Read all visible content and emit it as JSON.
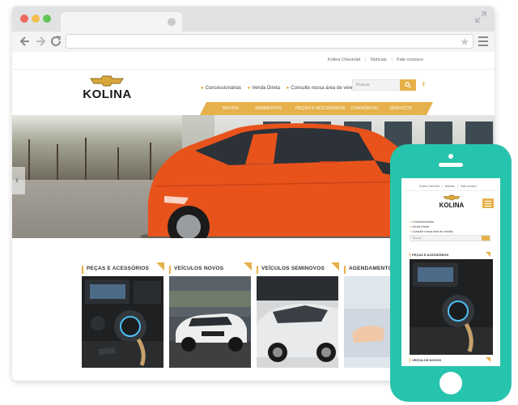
{
  "site": {
    "top_links": [
      "Kolina Chevrolet",
      "Notícias",
      "Fale conosco"
    ],
    "logo_text": "KOLINA",
    "quick_links": [
      "Concessionárias",
      "Venda Direta",
      "Consulte nossa área de vendas"
    ],
    "search_placeholder": "Buscar",
    "social": "f",
    "nav": [
      "NOVOS",
      "SEMINOVOS",
      "PEÇAS E ACESSÓRIOS",
      "CONSÓRCIO",
      "SERVIÇOS"
    ],
    "sections": [
      "PEÇAS E ACESSÓRIOS",
      "VEÍCULOS NOVOS",
      "VEÍCULOS SEMINOVOS",
      "AGENDAMENTO DE S"
    ]
  },
  "mobile": {
    "top_links": [
      "Kolina Chevrolet",
      "Notícias",
      "Fale conosco"
    ],
    "logo_text": "KOLINA",
    "links": [
      "Concessionárias",
      "Venda Direta",
      "Consulte nossa área de vendas"
    ],
    "search_placeholder": "Buscar",
    "sections": [
      "PEÇAS E ACESSÓRIOS",
      "VEÍCULOS NOVOS"
    ]
  },
  "colors": {
    "accent": "#e6b14a",
    "phone": "#27c4ad",
    "car": "#e8531c"
  }
}
